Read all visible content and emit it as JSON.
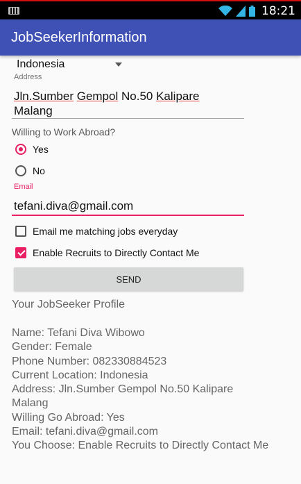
{
  "status_bar": {
    "time": "18:21"
  },
  "app_bar": {
    "title": "JobSeekerInformation"
  },
  "form": {
    "country_selected": "Indonesia",
    "address_label": "Address",
    "address_words": [
      "Jln.Sumber",
      "Gempol",
      "No.50",
      "Kalipare",
      "Malang"
    ],
    "abroad_question": "Willing to Work Abroad?",
    "radio_yes_label": "Yes",
    "radio_no_label": "No",
    "email_label": "Email",
    "email_value": "tefani.diva@gmail.com",
    "checkbox_matching_label": "Email me matching jobs everyday",
    "checkbox_recruits_label": "Enable Recruits to Directly Contact Me",
    "send_label": "SEND"
  },
  "profile": {
    "heading": "Your JobSeeker Profile",
    "lines": [
      "Name: Tefani Diva Wibowo",
      "Gender: Female",
      "Phone Number: 082330884523",
      "Current Location: Indonesia",
      "Address: Jln.Sumber Gempol No.50 Kalipare",
      "Malang",
      "Willing Go Abroad: Yes",
      "Email: tefani.diva@gmail.com",
      "You Choose: Enable Recruits to Directly Contact Me"
    ]
  },
  "colors": {
    "primary": "#3f51b5",
    "accent": "#e91e63"
  }
}
